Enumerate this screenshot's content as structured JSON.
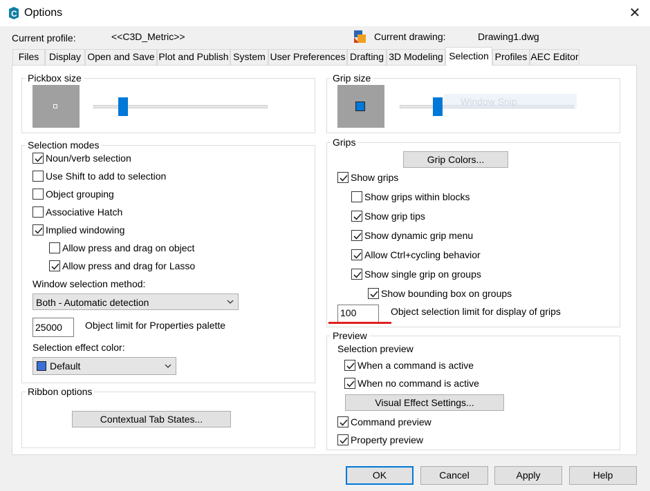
{
  "window": {
    "title": "Options",
    "close_glyph": "✕"
  },
  "header": {
    "profile_label": "Current profile:",
    "profile_value": "<<C3D_Metric>>",
    "drawing_label": "Current drawing:",
    "drawing_value": "Drawing1.dwg"
  },
  "tabs": [
    {
      "label": "Files"
    },
    {
      "label": "Display"
    },
    {
      "label": "Open and Save"
    },
    {
      "label": "Plot and Publish"
    },
    {
      "label": "System"
    },
    {
      "label": "User Preferences"
    },
    {
      "label": "Drafting"
    },
    {
      "label": "3D Modeling"
    },
    {
      "label": "Selection"
    },
    {
      "label": "Profiles"
    },
    {
      "label": "AEC Editor"
    }
  ],
  "active_tab": "Selection",
  "pickbox": {
    "title": "Pickbox size",
    "slider_level": 0.17
  },
  "selection_modes": {
    "title": "Selection modes",
    "items": [
      {
        "label": "Noun/verb selection",
        "checked": true
      },
      {
        "label": "Use Shift to add to selection",
        "checked": false
      },
      {
        "label": "Object grouping",
        "checked": false
      },
      {
        "label": "Associative Hatch",
        "checked": false
      },
      {
        "label": "Implied windowing",
        "checked": true
      },
      {
        "label": "Allow press and drag on object",
        "checked": false
      },
      {
        "label": "Allow press and drag for Lasso",
        "checked": true
      }
    ],
    "window_method_label": "Window selection method:",
    "window_method_value": "Both - Automatic detection",
    "object_limit_value": "25000",
    "object_limit_label": "Object limit for Properties palette",
    "effect_color_label": "Selection effect color:",
    "effect_color_value": "Default",
    "effect_color_swatch": "#3a6fd8"
  },
  "ribbon": {
    "title": "Ribbon options",
    "button": "Contextual Tab States..."
  },
  "grip_size": {
    "title": "Grip size",
    "slider_level": 0.22,
    "overlay_text": "Window Snip"
  },
  "grips": {
    "title": "Grips",
    "colors_button": "Grip Colors...",
    "items": [
      {
        "label": "Show grips",
        "checked": true
      },
      {
        "label": "Show grips within blocks",
        "checked": false
      },
      {
        "label": "Show grip tips",
        "checked": true
      },
      {
        "label": "Show dynamic grip menu",
        "checked": true
      },
      {
        "label": "Allow Ctrl+cycling behavior",
        "checked": true
      },
      {
        "label": "Show single grip on groups",
        "checked": true
      },
      {
        "label": "Show bounding box on groups",
        "checked": true
      }
    ],
    "limit_value": "100",
    "limit_label": "Object selection limit for display of grips"
  },
  "preview": {
    "title": "Preview",
    "subtitle": "Selection preview",
    "items": [
      {
        "label": "When a command is active",
        "checked": true
      },
      {
        "label": "When no command is active",
        "checked": true
      }
    ],
    "visual_button": "Visual Effect Settings...",
    "extra": [
      {
        "label": "Command preview",
        "checked": true
      },
      {
        "label": "Property preview",
        "checked": true
      }
    ]
  },
  "footer": {
    "ok": "OK",
    "cancel": "Cancel",
    "apply": "Apply",
    "help": "Help"
  },
  "colors": {
    "accent": "#0078d7",
    "annotation": "#e0201e",
    "grip": "#0078d7"
  }
}
